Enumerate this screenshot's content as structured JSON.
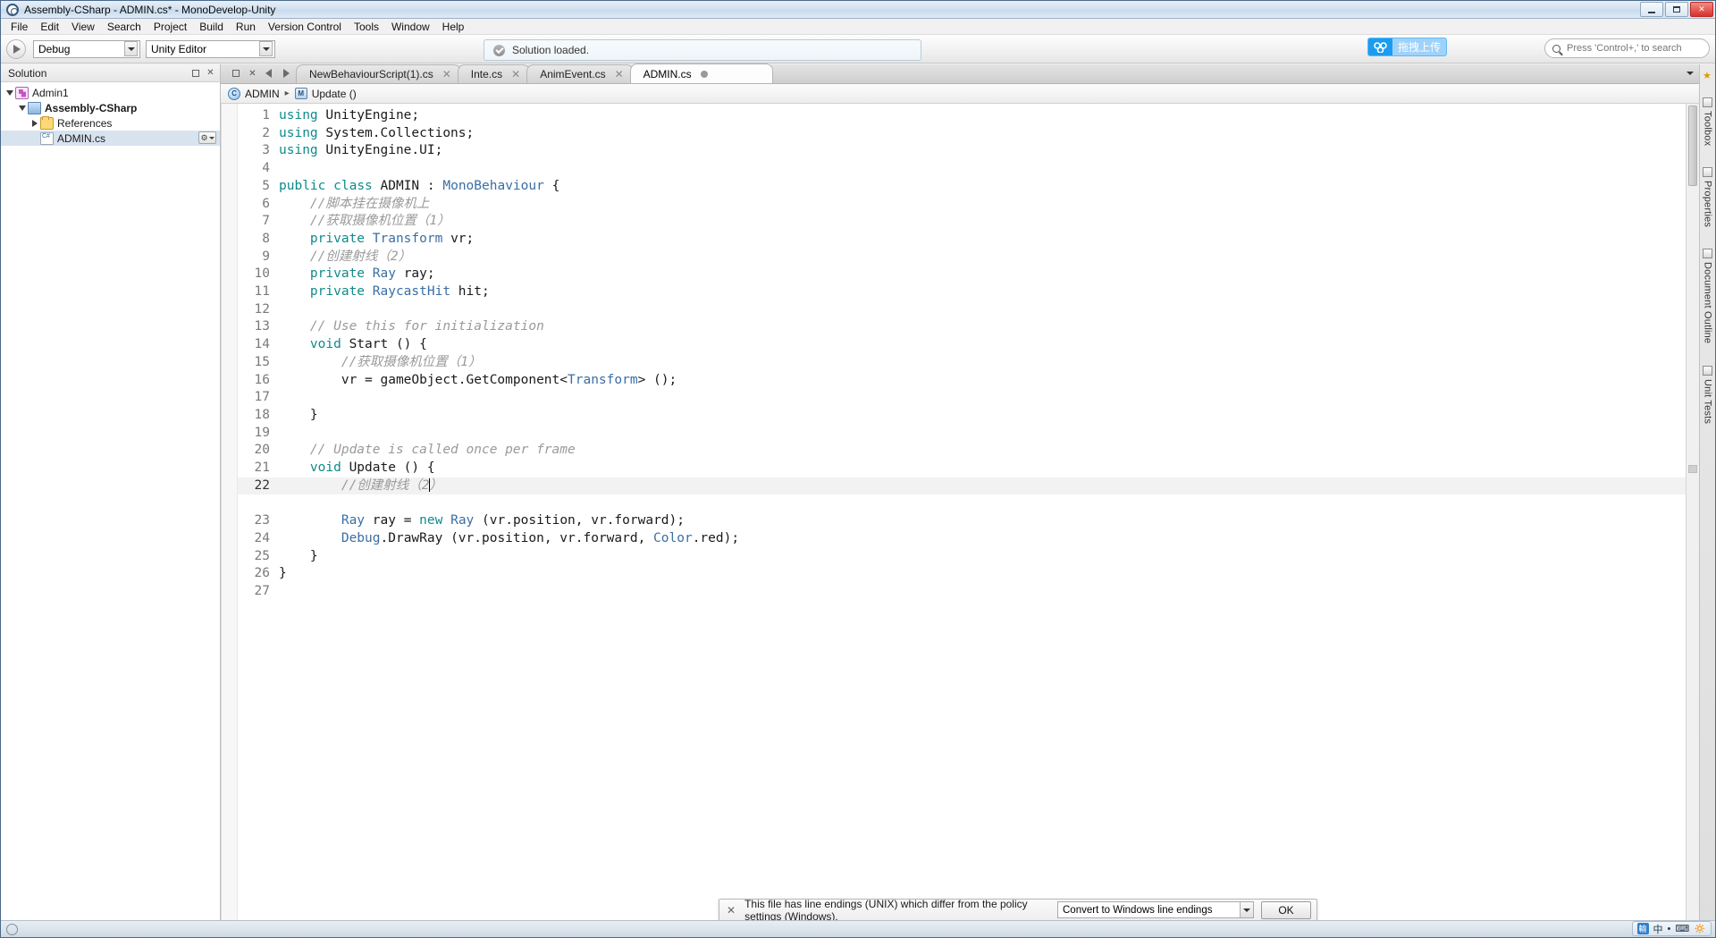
{
  "window": {
    "title": "Assembly-CSharp - ADMIN.cs* - MonoDevelop-Unity",
    "app_icon": "monodevelop-icon",
    "minimize": "minimize-icon",
    "maximize": "maximize-icon",
    "close": "✕"
  },
  "menubar": [
    {
      "label": "File"
    },
    {
      "label": "Edit"
    },
    {
      "label": "View"
    },
    {
      "label": "Search"
    },
    {
      "label": "Project"
    },
    {
      "label": "Build"
    },
    {
      "label": "Run"
    },
    {
      "label": "Version Control"
    },
    {
      "label": "Tools"
    },
    {
      "label": "Window"
    },
    {
      "label": "Help"
    }
  ],
  "toolbar": {
    "run_button": "run-play-icon",
    "configuration": "Debug",
    "target": "Unity Editor",
    "status_message": "Solution loaded.",
    "upload_badge": "拖拽上传",
    "search_placeholder": "Press 'Control+,' to search"
  },
  "solution_pad": {
    "title": "Solution",
    "tree": [
      {
        "label": "Admin1",
        "icon": "solution-icon",
        "indent": 0,
        "expander": "down",
        "bold": false
      },
      {
        "label": "Assembly-CSharp",
        "icon": "project-icon",
        "indent": 1,
        "expander": "down",
        "bold": true
      },
      {
        "label": "References",
        "icon": "folder-icon",
        "indent": 2,
        "expander": "right",
        "bold": false
      },
      {
        "label": "ADMIN.cs",
        "icon": "csharp-file-icon",
        "indent": 2,
        "expander": "none",
        "bold": false,
        "selected": true,
        "gear": "⚙"
      }
    ]
  },
  "tabs": [
    {
      "label": "NewBehaviourScript(1).cs",
      "active": false,
      "close": "✕"
    },
    {
      "label": "Inte.cs",
      "active": false,
      "close": "✕"
    },
    {
      "label": "AnimEvent.cs",
      "active": false,
      "close": "✕"
    },
    {
      "label": "ADMIN.cs",
      "active": true,
      "close": "●"
    }
  ],
  "breadcrumb": {
    "class_icon": "C",
    "class_name": "ADMIN",
    "separator": "▸",
    "method_icon": "M",
    "method_name": "Update ()"
  },
  "code": {
    "language": "csharp",
    "cursor_line": 22,
    "lines": [
      {
        "n": 1,
        "tokens": [
          {
            "t": "using",
            "c": "k"
          },
          {
            "t": " UnityEngine;",
            "c": "pl"
          }
        ]
      },
      {
        "n": 2,
        "tokens": [
          {
            "t": "using",
            "c": "k"
          },
          {
            "t": " System.Collections;",
            "c": "pl"
          }
        ]
      },
      {
        "n": 3,
        "tokens": [
          {
            "t": "using",
            "c": "k"
          },
          {
            "t": " UnityEngine.UI;",
            "c": "pl"
          }
        ]
      },
      {
        "n": 4,
        "tokens": []
      },
      {
        "n": 5,
        "tokens": [
          {
            "t": "public",
            "c": "k"
          },
          {
            "t": " ",
            "c": "pl"
          },
          {
            "t": "class",
            "c": "k"
          },
          {
            "t": " ADMIN : ",
            "c": "pl"
          },
          {
            "t": "MonoBehaviour",
            "c": "ty"
          },
          {
            "t": " {",
            "c": "pl"
          }
        ]
      },
      {
        "n": 6,
        "tokens": [
          {
            "t": "    //脚本挂在摄像机上",
            "c": "cm"
          }
        ]
      },
      {
        "n": 7,
        "tokens": [
          {
            "t": "    //获取摄像机位置（1）",
            "c": "cm"
          }
        ]
      },
      {
        "n": 8,
        "tokens": [
          {
            "t": "    ",
            "c": "pl"
          },
          {
            "t": "private",
            "c": "k"
          },
          {
            "t": " ",
            "c": "pl"
          },
          {
            "t": "Transform",
            "c": "ty"
          },
          {
            "t": " vr;",
            "c": "pl"
          }
        ]
      },
      {
        "n": 9,
        "tokens": [
          {
            "t": "    //创建射线（2）",
            "c": "cm"
          }
        ]
      },
      {
        "n": 10,
        "tokens": [
          {
            "t": "    ",
            "c": "pl"
          },
          {
            "t": "private",
            "c": "k"
          },
          {
            "t": " ",
            "c": "pl"
          },
          {
            "t": "Ray",
            "c": "ty"
          },
          {
            "t": " ray;",
            "c": "pl"
          }
        ]
      },
      {
        "n": 11,
        "tokens": [
          {
            "t": "    ",
            "c": "pl"
          },
          {
            "t": "private",
            "c": "k"
          },
          {
            "t": " ",
            "c": "pl"
          },
          {
            "t": "RaycastHit",
            "c": "ty"
          },
          {
            "t": " hit;",
            "c": "pl"
          }
        ]
      },
      {
        "n": 12,
        "tokens": []
      },
      {
        "n": 13,
        "tokens": [
          {
            "t": "    // Use this for initialization",
            "c": "cm"
          }
        ]
      },
      {
        "n": 14,
        "tokens": [
          {
            "t": "    ",
            "c": "pl"
          },
          {
            "t": "void",
            "c": "k"
          },
          {
            "t": " Start () {",
            "c": "pl"
          }
        ]
      },
      {
        "n": 15,
        "tokens": [
          {
            "t": "        //获取摄像机位置（1）",
            "c": "cm"
          }
        ]
      },
      {
        "n": 16,
        "tokens": [
          {
            "t": "        vr = gameObject.GetComponent<",
            "c": "pl"
          },
          {
            "t": "Transform",
            "c": "ty"
          },
          {
            "t": "> ();",
            "c": "pl"
          }
        ]
      },
      {
        "n": 17,
        "tokens": []
      },
      {
        "n": 18,
        "tokens": [
          {
            "t": "    }",
            "c": "pl"
          }
        ]
      },
      {
        "n": 19,
        "tokens": []
      },
      {
        "n": 20,
        "tokens": [
          {
            "t": "    // Update is called once per frame",
            "c": "cm"
          }
        ]
      },
      {
        "n": 21,
        "tokens": [
          {
            "t": "    ",
            "c": "pl"
          },
          {
            "t": "void",
            "c": "k"
          },
          {
            "t": " Update () {",
            "c": "pl"
          }
        ]
      },
      {
        "n": 22,
        "tokens": [
          {
            "t": "        //创建射线（2",
            "c": "cm"
          },
          {
            "t": "CARET",
            "c": "caret"
          },
          {
            "t": "）",
            "c": "cm"
          }
        ]
      },
      {
        "n": 23,
        "tokens": [
          {
            "t": "        ",
            "c": "pl"
          },
          {
            "t": "Ray",
            "c": "ty"
          },
          {
            "t": " ray = ",
            "c": "pl"
          },
          {
            "t": "new",
            "c": "k"
          },
          {
            "t": " ",
            "c": "pl"
          },
          {
            "t": "Ray",
            "c": "ty"
          },
          {
            "t": " (vr.position, vr.forward);",
            "c": "pl"
          }
        ]
      },
      {
        "n": 24,
        "tokens": [
          {
            "t": "        ",
            "c": "pl"
          },
          {
            "t": "Debug",
            "c": "ty"
          },
          {
            "t": ".DrawRay (vr.position, vr.forward, ",
            "c": "pl"
          },
          {
            "t": "Color",
            "c": "ty"
          },
          {
            "t": ".red);",
            "c": "pl"
          }
        ]
      },
      {
        "n": 25,
        "tokens": [
          {
            "t": "    }",
            "c": "pl"
          }
        ]
      },
      {
        "n": 26,
        "tokens": [
          {
            "t": "}",
            "c": "pl"
          }
        ]
      },
      {
        "n": 27,
        "tokens": []
      }
    ]
  },
  "notification": {
    "close": "✕",
    "message": "This file has line endings (UNIX) which differ from the policy settings (Windows).",
    "action_option": "Convert to Windows line endings",
    "ok_label": "OK"
  },
  "right_dock": [
    {
      "label": "Toolbox",
      "icon": "toolbox-icon"
    },
    {
      "label": "Properties",
      "icon": "properties-icon"
    },
    {
      "label": "Document Outline",
      "icon": "outline-icon"
    },
    {
      "label": "Unit Tests",
      "icon": "unit-tests-icon"
    }
  ],
  "taskbar": {
    "ime_items": [
      "中",
      "•",
      "⌨",
      "🔅"
    ]
  },
  "colors": {
    "keyword": "#0f8a8a",
    "type": "#3a6ea5",
    "comment": "#9a9a9a",
    "accent_blue": "#1c9cf0",
    "selection": "#d8e3f0"
  }
}
